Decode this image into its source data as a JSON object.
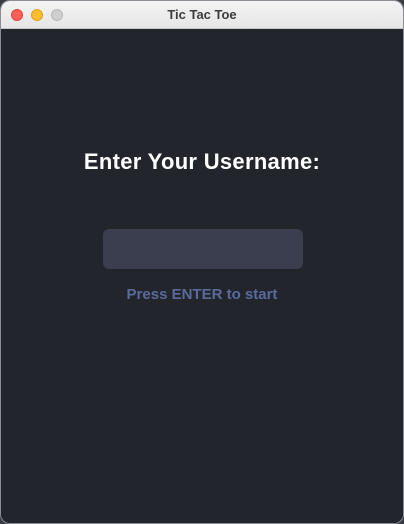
{
  "window": {
    "title": "Tic Tac Toe"
  },
  "screen": {
    "prompt": "Enter Your Username:",
    "username_value": "",
    "hint": "Press ENTER to start"
  },
  "colors": {
    "background": "#23252d",
    "input_background": "#3b3e4e",
    "hint_text": "#5a6b9b"
  }
}
